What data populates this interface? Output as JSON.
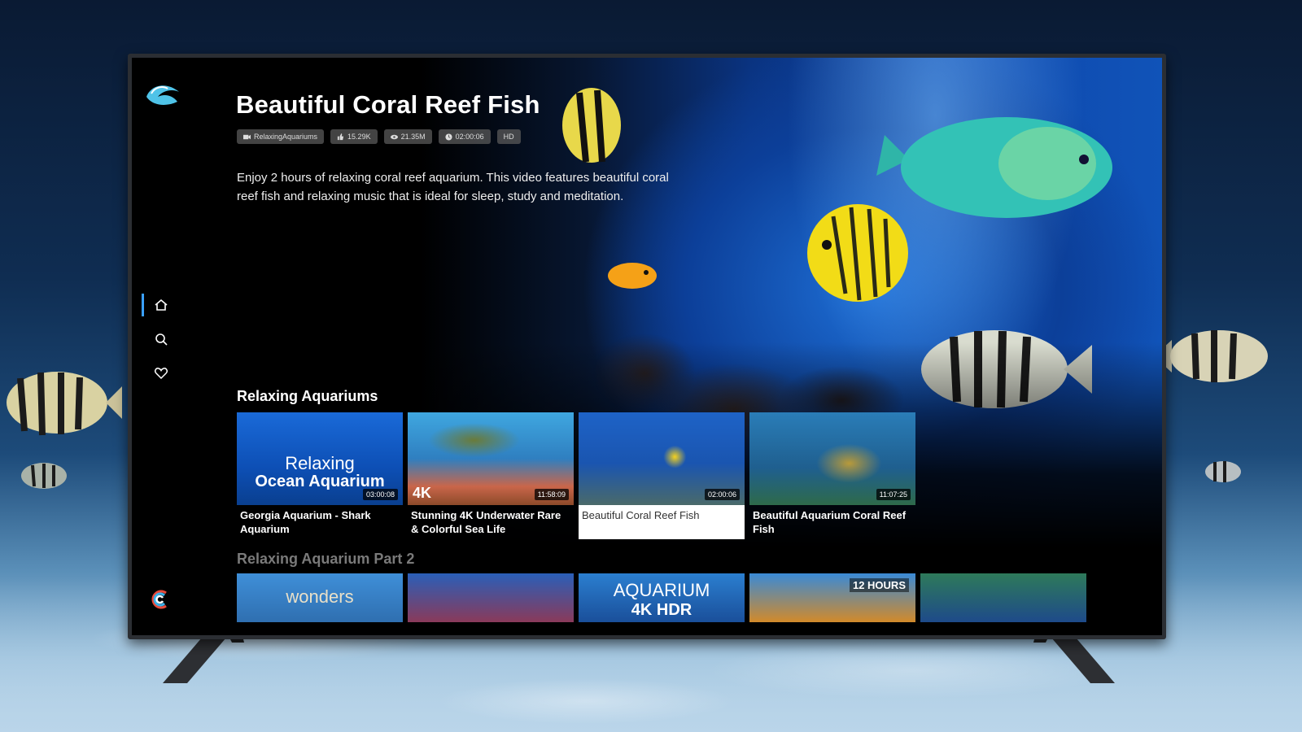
{
  "hero": {
    "title": "Beautiful Coral Reef Fish",
    "meta": {
      "channel": "RelaxingAquariums",
      "likes": "15.29K",
      "views": "21.35M",
      "duration": "02:00:06",
      "quality": "HD"
    },
    "description": "Enjoy 2 hours of relaxing coral reef aquarium. This video features beautiful coral reef fish and relaxing music that is ideal for sleep, study and meditation."
  },
  "sidebar": {
    "items": [
      {
        "icon": "home-icon"
      },
      {
        "icon": "search-icon"
      },
      {
        "icon": "heart-icon"
      }
    ]
  },
  "sections": [
    {
      "title": "Relaxing Aquariums",
      "cards": [
        {
          "title": "Georgia Aquarium - Shark Aquarium",
          "duration": "03:00:08",
          "overlay_line1": "Relaxing",
          "overlay_line2": "Ocean Aquarium"
        },
        {
          "title": "Stunning 4K Underwater Rare & Colorful Sea Life",
          "duration": "11:58:09",
          "badge": "4K"
        },
        {
          "title": "Beautiful Coral Reef Fish",
          "duration": "02:00:06"
        },
        {
          "title": "Beautiful Aquarium Coral Reef Fish",
          "duration": "11:07:25"
        }
      ]
    },
    {
      "title": "Relaxing Aquarium Part 2",
      "cards": [
        {
          "overlay": "wonders"
        },
        {},
        {
          "overlay_line1": "AQUARIUM",
          "overlay_line2": "4K HDR"
        },
        {
          "overlay": "12 HOURS"
        },
        {}
      ]
    }
  ],
  "colors": {
    "accent": "#3aa0ff",
    "focus_bg": "#ffffff"
  }
}
